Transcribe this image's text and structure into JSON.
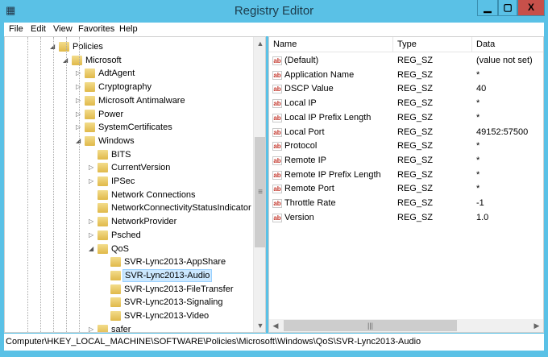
{
  "window": {
    "title": "Registry Editor",
    "icon": "regedit-icon",
    "minimize": "▁",
    "maximize": "▢",
    "close": "X"
  },
  "menu": [
    "File",
    "Edit",
    "View",
    "Favorites",
    "Help"
  ],
  "tree": [
    {
      "label": "Policies",
      "level": 0,
      "expander": "expanded"
    },
    {
      "label": "Microsoft",
      "level": 1,
      "expander": "expanded"
    },
    {
      "label": "AdtAgent",
      "level": 2,
      "expander": "collapsed"
    },
    {
      "label": "Cryptography",
      "level": 2,
      "expander": "collapsed"
    },
    {
      "label": "Microsoft Antimalware",
      "level": 2,
      "expander": "collapsed"
    },
    {
      "label": "Power",
      "level": 2,
      "expander": "collapsed"
    },
    {
      "label": "SystemCertificates",
      "level": 2,
      "expander": "collapsed"
    },
    {
      "label": "Windows",
      "level": 2,
      "expander": "expanded"
    },
    {
      "label": "BITS",
      "level": 3,
      "expander": "none"
    },
    {
      "label": "CurrentVersion",
      "level": 3,
      "expander": "collapsed"
    },
    {
      "label": "IPSec",
      "level": 3,
      "expander": "collapsed"
    },
    {
      "label": "Network Connections",
      "level": 3,
      "expander": "none"
    },
    {
      "label": "NetworkConnectivityStatusIndicator",
      "level": 3,
      "expander": "none"
    },
    {
      "label": "NetworkProvider",
      "level": 3,
      "expander": "collapsed"
    },
    {
      "label": "Psched",
      "level": 3,
      "expander": "collapsed"
    },
    {
      "label": "QoS",
      "level": 3,
      "expander": "expanded"
    },
    {
      "label": "SVR-Lync2013-AppShare",
      "level": 4,
      "expander": "none"
    },
    {
      "label": "SVR-Lync2013-Audio",
      "level": 4,
      "expander": "none",
      "selected": true
    },
    {
      "label": "SVR-Lync2013-FileTransfer",
      "level": 4,
      "expander": "none"
    },
    {
      "label": "SVR-Lync2013-Signaling",
      "level": 4,
      "expander": "none"
    },
    {
      "label": "SVR-Lync2013-Video",
      "level": 4,
      "expander": "none"
    },
    {
      "label": "safer",
      "level": 3,
      "expander": "collapsed"
    }
  ],
  "list": {
    "columns": [
      "Name",
      "Type",
      "Data"
    ],
    "rows": [
      {
        "name": "(Default)",
        "type": "REG_SZ",
        "data": "(value not set)"
      },
      {
        "name": "Application Name",
        "type": "REG_SZ",
        "data": "*"
      },
      {
        "name": "DSCP Value",
        "type": "REG_SZ",
        "data": "40"
      },
      {
        "name": "Local IP",
        "type": "REG_SZ",
        "data": "*"
      },
      {
        "name": "Local IP Prefix Length",
        "type": "REG_SZ",
        "data": "*"
      },
      {
        "name": "Local Port",
        "type": "REG_SZ",
        "data": "49152:57500"
      },
      {
        "name": "Protocol",
        "type": "REG_SZ",
        "data": "*"
      },
      {
        "name": "Remote IP",
        "type": "REG_SZ",
        "data": "*"
      },
      {
        "name": "Remote IP Prefix Length",
        "type": "REG_SZ",
        "data": "*"
      },
      {
        "name": "Remote Port",
        "type": "REG_SZ",
        "data": "*"
      },
      {
        "name": "Throttle Rate",
        "type": "REG_SZ",
        "data": "-1"
      },
      {
        "name": "Version",
        "type": "REG_SZ",
        "data": "1.0"
      }
    ],
    "value_icon_text": "ab"
  },
  "status": {
    "path": "Computer\\HKEY_LOCAL_MACHINE\\SOFTWARE\\Policies\\Microsoft\\Windows\\QoS\\SVR-Lync2013-Audio"
  }
}
